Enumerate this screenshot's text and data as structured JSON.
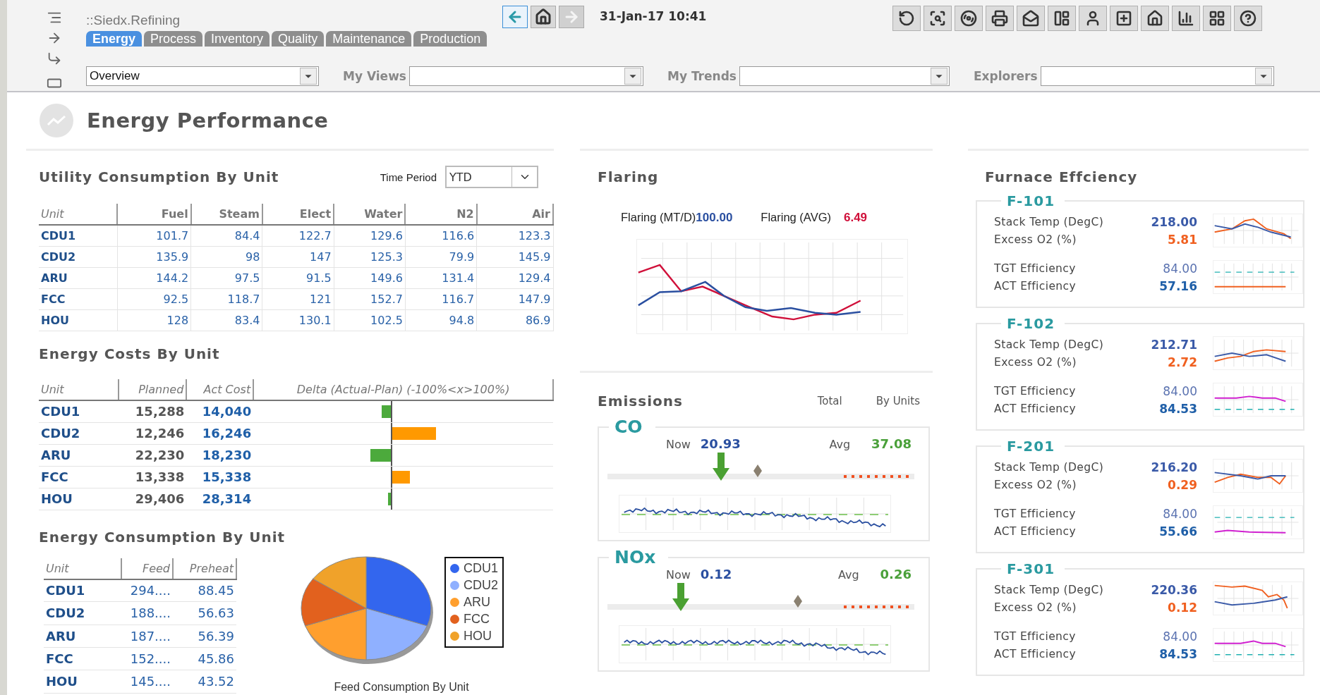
{
  "app": {
    "breadcrumb": "::Siedx.Refining",
    "datetime": "31-Jan-17 10:41"
  },
  "tabs": [
    {
      "label": "Energy",
      "selected": true
    },
    {
      "label": "Process",
      "selected": false
    },
    {
      "label": "Inventory",
      "selected": false
    },
    {
      "label": "Quality",
      "selected": false
    },
    {
      "label": "Maintenance",
      "selected": false
    },
    {
      "label": "Production",
      "selected": false
    }
  ],
  "nav_buttons": [
    {
      "kind": "back",
      "disabled": false
    },
    {
      "kind": "home",
      "disabled": false
    },
    {
      "kind": "forward",
      "disabled": true
    }
  ],
  "selectors": [
    {
      "value": "Overview"
    },
    {
      "label": "My Views"
    },
    {
      "label": "My Trends"
    },
    {
      "label": "Explorers"
    }
  ],
  "page_title": "Energy Performance",
  "utility": {
    "title": "Utility Consumption By Unit",
    "period_label": "Time Period",
    "period": "YTD",
    "columns": [
      "Unit",
      "Fuel",
      "Steam",
      "Elect",
      "Water",
      "N2",
      "Air"
    ],
    "rows": [
      [
        "CDU1",
        "101.7",
        "84.4",
        "122.7",
        "129.6",
        "116.6",
        "123.3"
      ],
      [
        "CDU2",
        "135.9",
        "98",
        "147",
        "125.3",
        "79.9",
        "145.9"
      ],
      [
        "ARU",
        "144.2",
        "97.5",
        "91.5",
        "149.6",
        "131.4",
        "129.4"
      ],
      [
        "FCC",
        "92.5",
        "118.7",
        "121",
        "152.7",
        "116.7",
        "147.9"
      ],
      [
        "HOU",
        "128",
        "83.4",
        "130.1",
        "102.5",
        "94.8",
        "86.9"
      ]
    ]
  },
  "costs": {
    "title": "Energy Costs By Unit",
    "columns": [
      "Unit",
      "Planned",
      "Act Cost",
      "Delta (Actual-Plan)  (-100%<x>100%)"
    ],
    "rows": [
      {
        "unit": "CDU1",
        "planned": "15,288",
        "actual": "14,040",
        "kind": "under",
        "color": "#4caa3c"
      },
      {
        "unit": "CDU2",
        "planned": "12,246",
        "actual": "16,246",
        "kind": "over",
        "level": 0.27,
        "color": "#ff9900"
      },
      {
        "unit": "ARU",
        "planned": "22,230",
        "actual": "18,230",
        "kind": "under",
        "color": "#4caa3c"
      },
      {
        "unit": "FCC",
        "planned": "13,338",
        "actual": "15,338",
        "kind": "over",
        "level": 0.11,
        "color": "#ff9900"
      },
      {
        "unit": "HOU",
        "planned": "29,406",
        "actual": "28,314",
        "kind": "under",
        "color": "#4caa3c"
      }
    ]
  },
  "consumption": {
    "title": "Energy Consumption By Unit",
    "columns": [
      "Unit",
      "Feed",
      "Preheat"
    ],
    "rows": [
      [
        "CDU1",
        "294....",
        "88.45"
      ],
      [
        "CDU2",
        "188....",
        "56.63"
      ],
      [
        "ARU",
        "187....",
        "56.39"
      ],
      [
        "FCC",
        "152....",
        "45.86"
      ],
      [
        "HOU",
        "145....",
        "43.52"
      ]
    ],
    "legend": [
      {
        "label": "CDU1",
        "color": "#3366ee"
      },
      {
        "label": "CDU2",
        "color": "#8fb0ff"
      },
      {
        "label": "ARU",
        "color": "#ff9f2e"
      },
      {
        "label": "FCC",
        "color": "#e2611e"
      },
      {
        "label": "HOU",
        "color": "#f0a22a"
      }
    ],
    "caption": "Feed Consumption By Unit"
  },
  "flaring": {
    "title": "Flaring",
    "readings": [
      {
        "kind": "actual",
        "label": "Flaring (MT/D)",
        "value": "100.00"
      },
      {
        "kind": "average",
        "label": "Flaring (AVG)",
        "value": "6.49"
      }
    ]
  },
  "emissions": {
    "title": "Emissions",
    "views": [
      "Total",
      "By Units"
    ],
    "gauges": [
      {
        "name": "CO",
        "now": {
          "label": "Now",
          "value": "20.93",
          "level": 0.37
        },
        "avg": {
          "label": "Avg",
          "value": "37.08",
          "level": 0.49
        }
      },
      {
        "name": "NOx",
        "now": {
          "label": "Now",
          "value": "0.12",
          "level": 0.24
        },
        "avg": {
          "label": "Avg",
          "value": "0.26",
          "level": 0.62
        }
      }
    ]
  },
  "furnaces": {
    "title": "Furnace Effciency",
    "units": [
      {
        "name": "F-101",
        "metrics": [
          {
            "kind": "stack",
            "label": "Stack Temp (DegC)",
            "value": "218.00"
          },
          {
            "kind": "o2",
            "label": "Excess O2 (%)",
            "value": "5.81"
          },
          {
            "kind": "target",
            "label": "TGT Efficiency",
            "value": "84.00"
          },
          {
            "kind": "actual",
            "label": "ACT Efficiency",
            "value": "57.16"
          }
        ]
      },
      {
        "name": "F-102",
        "metrics": [
          {
            "kind": "stack",
            "label": "Stack Temp (DegC)",
            "value": "212.71"
          },
          {
            "kind": "o2",
            "label": "Excess O2 (%)",
            "value": "2.72"
          },
          {
            "kind": "target",
            "label": "TGT Efficiency",
            "value": "84.00"
          },
          {
            "kind": "actual",
            "label": "ACT Efficiency",
            "value": "84.53"
          }
        ]
      },
      {
        "name": "F-201",
        "metrics": [
          {
            "kind": "stack",
            "label": "Stack Temp (DegC)",
            "value": "216.20"
          },
          {
            "kind": "o2",
            "label": "Excess O2 (%)",
            "value": "0.29"
          },
          {
            "kind": "target",
            "label": "TGT Efficiency",
            "value": "84.00"
          },
          {
            "kind": "actual",
            "label": "ACT Efficiency",
            "value": "55.66"
          }
        ]
      },
      {
        "name": "F-301",
        "metrics": [
          {
            "kind": "stack",
            "label": "Stack Temp (DegC)",
            "value": "220.36"
          },
          {
            "kind": "o2",
            "label": "Excess O2 (%)",
            "value": "0.12"
          },
          {
            "kind": "target",
            "label": "TGT Efficiency",
            "value": "84.00"
          },
          {
            "kind": "actual",
            "label": "ACT Efficiency",
            "value": "84.53"
          }
        ]
      }
    ]
  }
}
